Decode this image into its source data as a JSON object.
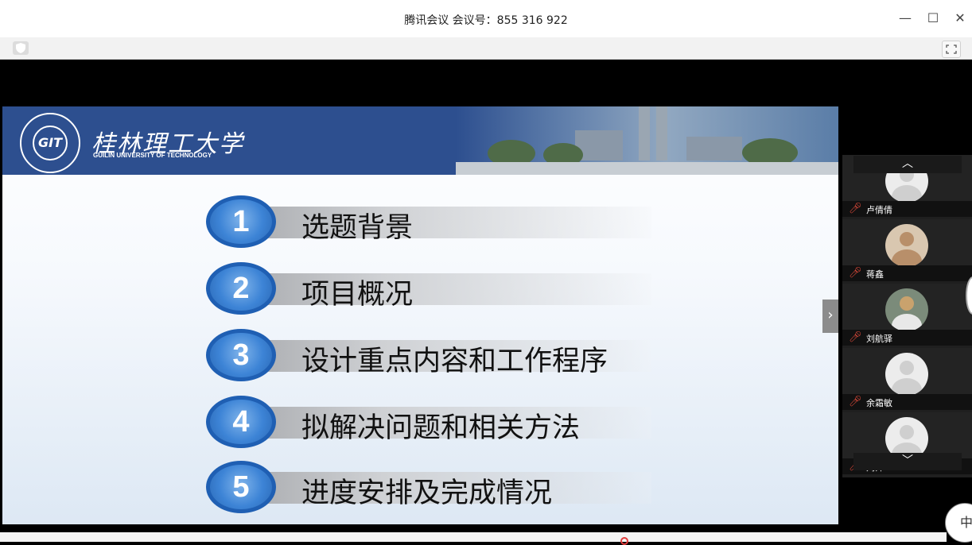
{
  "window": {
    "title": "腾讯会议 会议号：855 316 922",
    "minimize_glyph": "—",
    "maximize_glyph": "☐",
    "close_glyph": "✕"
  },
  "toolbar": {
    "icons": [
      "shield-icon",
      "fullscreen-icon"
    ]
  },
  "slide": {
    "university_cn": "桂林理工大学",
    "university_en": "GUILIN UNIVERSITY OF TECHNOLOGY",
    "logo_text": "GIT",
    "items": [
      {
        "num": "1",
        "text": "选题背景"
      },
      {
        "num": "2",
        "text": "项目概况"
      },
      {
        "num": "3",
        "text": "设计重点内容和工作程序"
      },
      {
        "num": "4",
        "text": "拟解决问题和相关方法"
      },
      {
        "num": "5",
        "text": "进度安排及完成情况"
      }
    ]
  },
  "side_panel": {
    "toggle_glyph": "›",
    "scroll_up": "︿",
    "scroll_down": "﹀",
    "participants": [
      {
        "name": "卢倩倩"
      },
      {
        "name": "蒋鑫"
      },
      {
        "name": "刘航驿"
      },
      {
        "name": "余霜敏"
      },
      {
        "name": "刘帅"
      }
    ]
  },
  "ime": {
    "label": "中"
  },
  "colors": {
    "slide_header": "#2d4f8f",
    "number_circle": "#3d84d6",
    "muted_mic": "#e04a3a"
  }
}
